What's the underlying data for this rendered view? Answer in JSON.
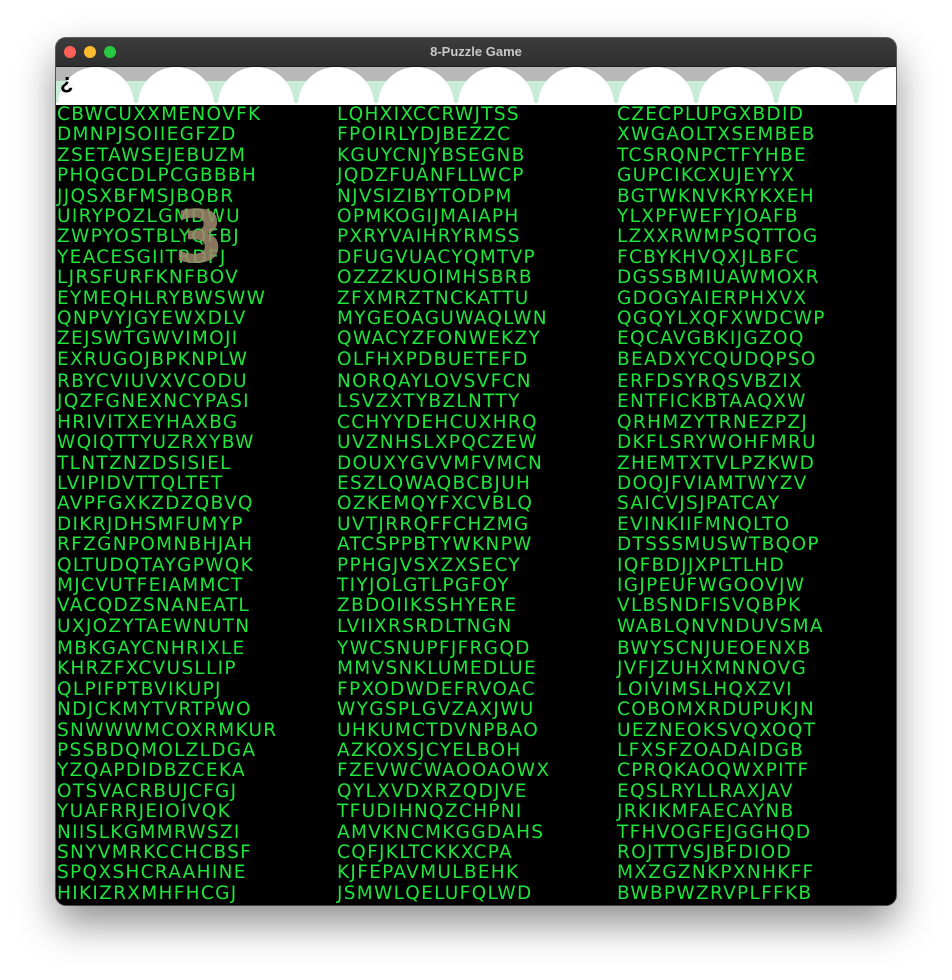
{
  "window": {
    "title": "8-Puzzle Game"
  },
  "menubar": {
    "glyph": "¿",
    "pattern_colors": [
      "#b8b8b8",
      "#ffffff",
      "#c9ecd9"
    ]
  },
  "colors": {
    "text_green": "#1fe43c",
    "background": "#000000",
    "tile_number": "#a08a6e"
  },
  "tile_number": "3",
  "tiles": [
    {
      "rows": [
        "CBWCUXXMENOVFK",
        "DMNPJSOIIEGFZD",
        "ZSETAWSEJEBUZM",
        "PHQGCDLPCGBBBH",
        "JJQSXBFMSJBQBR",
        "UIRYPOZLGMDWU",
        "ZWPYOSTBLYQFBJ",
        "YEACESGIITRDFJ",
        "LJRSFURFKNFBOV",
        "EYMEQHLRYBWSWW",
        "QNPVYJGYEWXDLV",
        "ZEJSWTGWVIMOJI",
        "EXRUGOJBPKNPLW"
      ]
    },
    {
      "rows": [
        "LQHXIXCCRWJTSS",
        "FPOIRLYDJBEZZC",
        "KGUYCNJYBSEGNB",
        "JQDZFUANFLLWCP",
        "NJVSIZIBYTODPM",
        "OPMKOGIJMAIAPH",
        "PXRYVAIHRYRMSS",
        "DFUGVUACYQMTVP",
        "OZZZKUOIMHSBRB",
        "ZFXMRZTNCKATTU",
        "MYGEOAGUWAQLWN",
        "QWACYZFONWEKZY",
        "OLFHXPDBUETEFD"
      ]
    },
    {
      "rows": [
        "CZECPLUPGXBDID",
        "XWGAOLTXSEMBEB",
        "TCSRQNPCTFYHBE",
        "GUPCIKCXUJEYYX",
        "BGTWKNVKRYKXEH",
        "YLXPFWEFYJOAFB",
        "LZXXRWMPSQTTOG",
        "FCBYKHVQXJLBFC",
        "DGSSBMIUAWMOXR",
        "GDOGYAIERPHXVX",
        "QGQYLXQFXWDCWP",
        "EQCAVGBKIJGZOQ",
        "BEADXYCQUDQPSO"
      ]
    },
    {
      "rows": [
        "RBYCVIUVXVCODU",
        "JQZFGNEXNCYPASI",
        "HRIVITXEYHAXBG",
        "WQIQTTYUZRXYBW",
        "TLNTZNZDSISIEL",
        "LVIPIDVTTQLTET",
        "AVPFGXKZDZQBVQ",
        "DIKRJDHSMFUMYP",
        "RFZGNPOMNBHJAH",
        "QLTUDQTAYGPWQK",
        "MJCVUTFEIAMMCT",
        "VACQDZSNANEATL",
        "UXJOZYTAEWNUTN"
      ]
    },
    {
      "rows": [
        "NORQAYLOVSVFCN",
        "LSVZXTYBZLNTTY",
        "CCHYYDEHCUXHRQ",
        "UVZNHSLXPQCZEW",
        "DOUXYGVVMFVMCN",
        "ESZLQWAQBCBJUH",
        "OZKEMQYFXCVBLQ",
        "UVTJRRQFFCHZMG",
        "ATCSPPBTYWKNPW",
        "PPHGJVSXZXSECY",
        "TIYJOLGTLPGFOY",
        "ZBDOIIKSSHYERE",
        "LVIIXRSRDLTNGN"
      ]
    },
    {
      "rows": [
        "ERFDSYRQSVBZIX",
        "ENTFICKBTAAQXW",
        "QRHMZYTRNEZPZJ",
        "DKFLSRYWOHFMRU",
        "ZHEMTXTVLPZKWD",
        "DOQJFVIAMTWYZV",
        "SAICVJSJPATCAY",
        "EVINKIIFMNQLTO",
        "DTSSSMUSWTBQOP",
        "IQFBDJJXPLTLHD",
        "IGJPEUFWGOOVJW",
        "VLBSNDFISVQBPK",
        "WABLQNVNDUVSMA"
      ]
    },
    {
      "rows": [
        "MBKGAYCNHRIXLE",
        "KHRZFXCVUSLLIP",
        "QLPIFPTBVIKUPJ",
        "NDJCKMYTVRTPWO",
        "SNWWWMCOXRMKUR",
        "PSSBDQMOLZLDGA",
        "YZQAPDIDBZCEKA",
        "OTSVACRBUJCFGJ",
        "YUAFRRJEIOIVQK",
        "NIISLKGMMRWSZI",
        "SNYVMRKCCHCBSF",
        "SPQXSHCRAAHINE",
        "HIKIZRXMHFHCGJ"
      ]
    },
    {
      "rows": [
        "YWCSNUPFJFRGQD",
        "MMVSNKLUMEDLUE",
        "FPXODWDEFRVOAC",
        "WYGSPLGVZAXJWU",
        "UHKUMCTDVNPBAO",
        "AZKOXSJCYELBOH",
        "FZEVWCWAOOAOWX",
        "QYLXVDXRZQDJVE",
        "TFUDIHNQZCHPNI",
        "AMVKNCMKGGDAHS",
        "CQFJKLTCKKXCPA",
        "KJFEPAVMULBEHK",
        "JSMWLQELUFQLWD"
      ]
    },
    {
      "rows": [
        "BWYSCNJUEOENXB",
        "JVFJZUHXMNNOVG",
        "LOIVIMSLHQXZVI",
        "COBOMXRDUPUKJN",
        "UEZNEOKSVQXOQT",
        "LFXSFZOADAIDGB",
        "CPRQKAOQWXPITF",
        "EQSLRYLLRAXJAV",
        "JRKIKMFAECAYNB",
        "TFHVOGFEJGGHQD",
        "ROJTTVSJBFDIOD",
        "MXZGZNKPXNHKFF",
        "BWBPWZRVPLFFKB"
      ]
    }
  ]
}
